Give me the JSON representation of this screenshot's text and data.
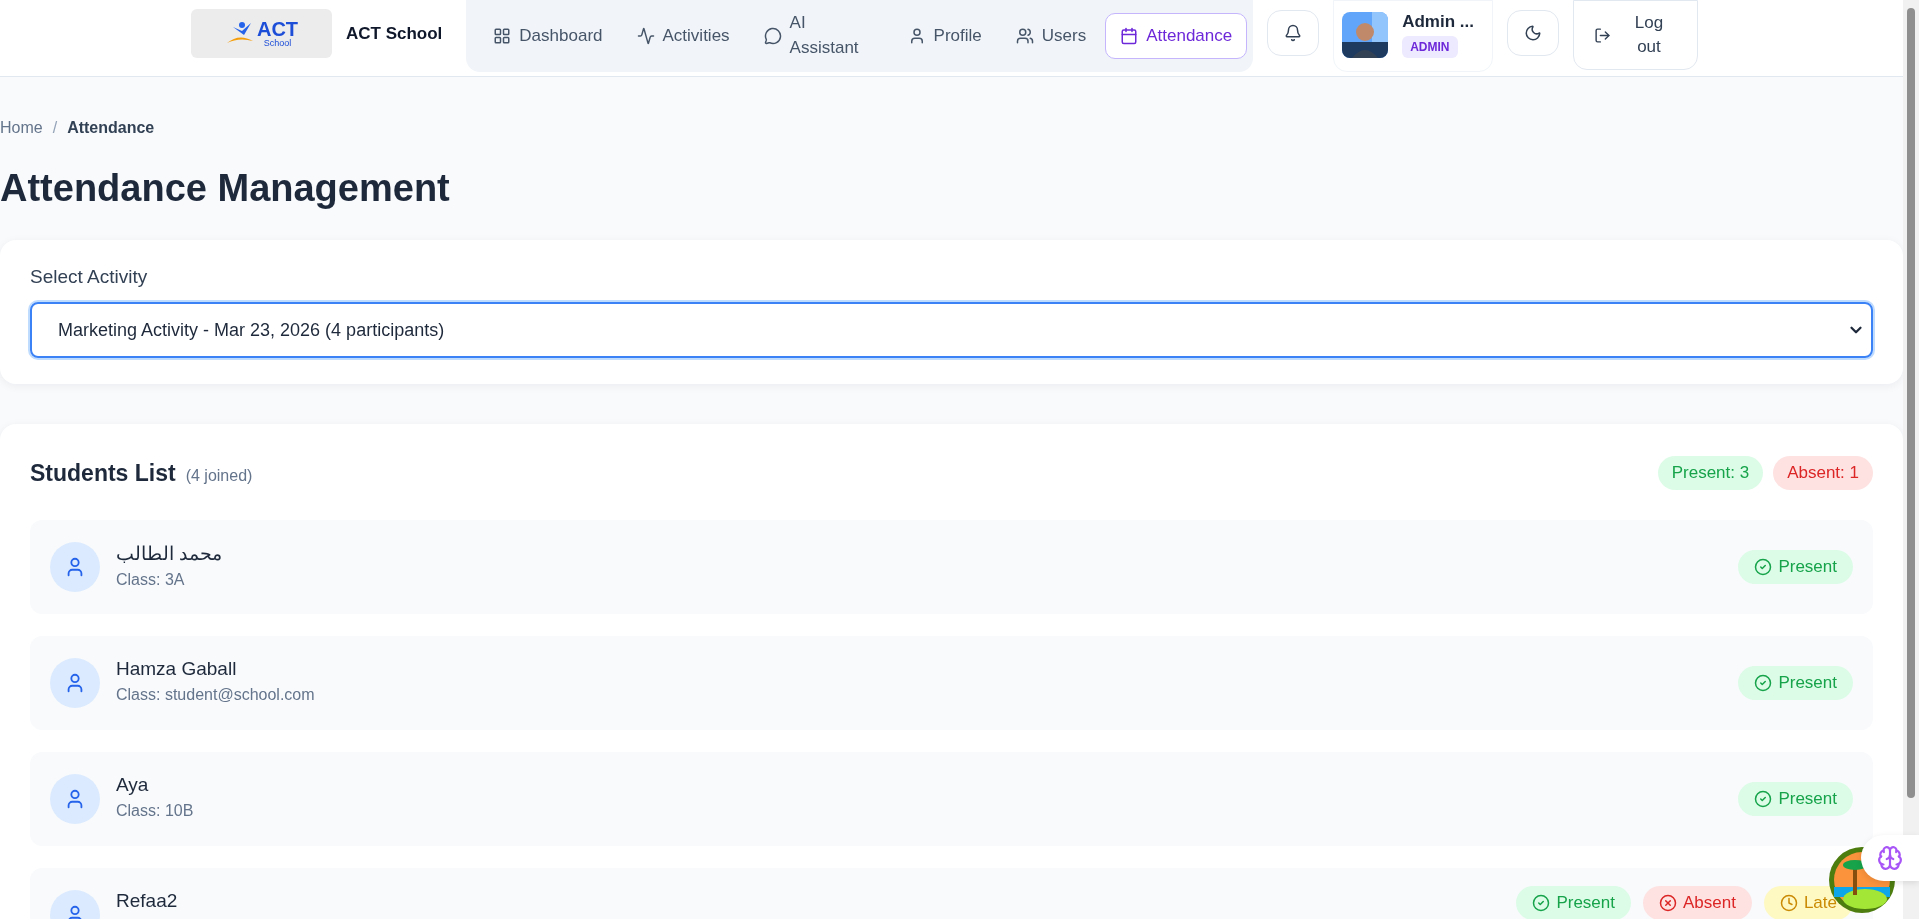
{
  "header": {
    "logo": {
      "text": "ACT",
      "subtext": "School"
    },
    "school_name": "ACT School",
    "nav": [
      {
        "label": "Dashboard",
        "selected": false
      },
      {
        "label": "Activities",
        "selected": false
      },
      {
        "label": "AI Assistant",
        "selected": false
      },
      {
        "label": "Profile",
        "selected": false
      },
      {
        "label": "Users",
        "selected": false
      },
      {
        "label": "Attendance",
        "selected": true
      }
    ],
    "user": {
      "name": "Admin ...",
      "role": "ADMIN"
    },
    "logout": "Log out"
  },
  "breadcrumb": [
    {
      "label": "Home",
      "current": false
    },
    {
      "label": "Attendance",
      "current": true
    }
  ],
  "breadcrumb_separator": "/",
  "title": "Attendance Management",
  "activity_select": {
    "label": "Select Activity",
    "value": "Marketing Activity - Mar 23, 2026 (4 participants)"
  },
  "students": {
    "title": "Students List",
    "count": "(4 joined)",
    "summary": [
      {
        "label": "Present: 3",
        "kind": "present"
      },
      {
        "label": "Absent: 1",
        "kind": "absent"
      }
    ],
    "rows": [
      {
        "name": "محمد الطالب",
        "class": "Class: 3A",
        "status": {
          "label": "Present",
          "kind": "present"
        }
      },
      {
        "name": "Hamza Gaball",
        "class": "Class: student@school.com",
        "status": {
          "label": "Present",
          "kind": "present"
        }
      },
      {
        "name": "Aya",
        "class": "Class: 10B",
        "status": {
          "label": "Present",
          "kind": "present"
        }
      },
      {
        "name": "Refaa2",
        "actions": [
          {
            "label": "Present",
            "kind": "present"
          },
          {
            "label": "Absent",
            "kind": "absent"
          },
          {
            "label": "Late",
            "kind": "late"
          }
        ]
      }
    ]
  }
}
